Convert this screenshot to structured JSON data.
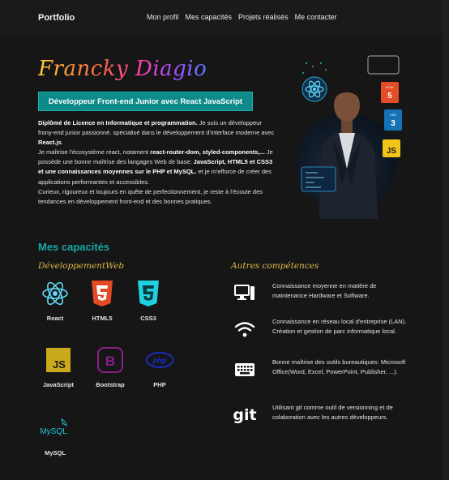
{
  "nav": {
    "brand": "Portfolio",
    "links": [
      "Mon profil",
      "Mes capacités",
      "Projets réalisés",
      "Me contacter"
    ]
  },
  "hero": {
    "name": "Francky Diagio",
    "badge": "Développeur Front-end Junior avec React JavaScript",
    "bio": {
      "p1_bold": "Diplômé de Licence en Informatique et programmation.",
      "p1_rest": " Je suis un développeur frony-end junior passionné. spécialisé dans le développement d'interface moderne avec ",
      "p1_bold2": "React.js",
      "p1_end": ".",
      "p2_start": "Je maîtrise l'écosystème react, notament ",
      "p2_bold": "react-router-dom, styled-components,...",
      "p2_rest": " Je possède une bonne maîtrise des langages Web de base: ",
      "p2_bold2": "JavaScript, HTML5 et CSS3 et une connaissances moyennes sur le PHP et MySQL.",
      "p2_end": " et je m'efforce de créer des applications performantes et accessibles.",
      "p3": "Curieux, rigoureux et toujours en quête de perfectionnement, je reste à l'écoute des tendances en développement front-end et des bonnes pratiques."
    },
    "photo_badges": [
      "HTML 5",
      "CSS 3",
      "JS"
    ]
  },
  "capacities": {
    "title": "Mes capacités",
    "web_title": "DéveloppementWeb",
    "other_title": "Autres compétences",
    "skills": [
      {
        "label": "React",
        "icon": "react-icon",
        "color": "#61dafb"
      },
      {
        "label": "HTML5",
        "icon": "html5-icon",
        "color": "#e34c26"
      },
      {
        "label": "CSS3",
        "icon": "css3-icon",
        "color": "#1fd0e0"
      },
      {
        "label": "JavaScript",
        "icon": "javascript-icon",
        "color": "#c9a81c"
      },
      {
        "label": "Bootstrap",
        "icon": "bootstrap-icon",
        "color": "#8a1e8a"
      },
      {
        "label": "PHP",
        "icon": "php-icon",
        "color": "#1a2fd0"
      },
      {
        "label": "MySQL",
        "icon": "mysql-icon",
        "color": "#1fc9d8"
      }
    ],
    "others": [
      {
        "icon": "computer-icon",
        "text": "Connaissance moyenne en matière de maintenance Hardware et Software."
      },
      {
        "icon": "wifi-icon",
        "text": "Connaissance en réseau local d'entreprise (LAN). Création et gestion de parc informatique local."
      },
      {
        "icon": "keyboard-icon",
        "text": "Bonne maîtrise des outils bureautiques: Microsoft Office(Word, Excel, PowerPoint, Publisher, ...)."
      },
      {
        "icon": "git-icon",
        "label": "git",
        "text": "Utilisant git comme outil de versionning et de colaboration avec les autres développeurs."
      }
    ]
  }
}
